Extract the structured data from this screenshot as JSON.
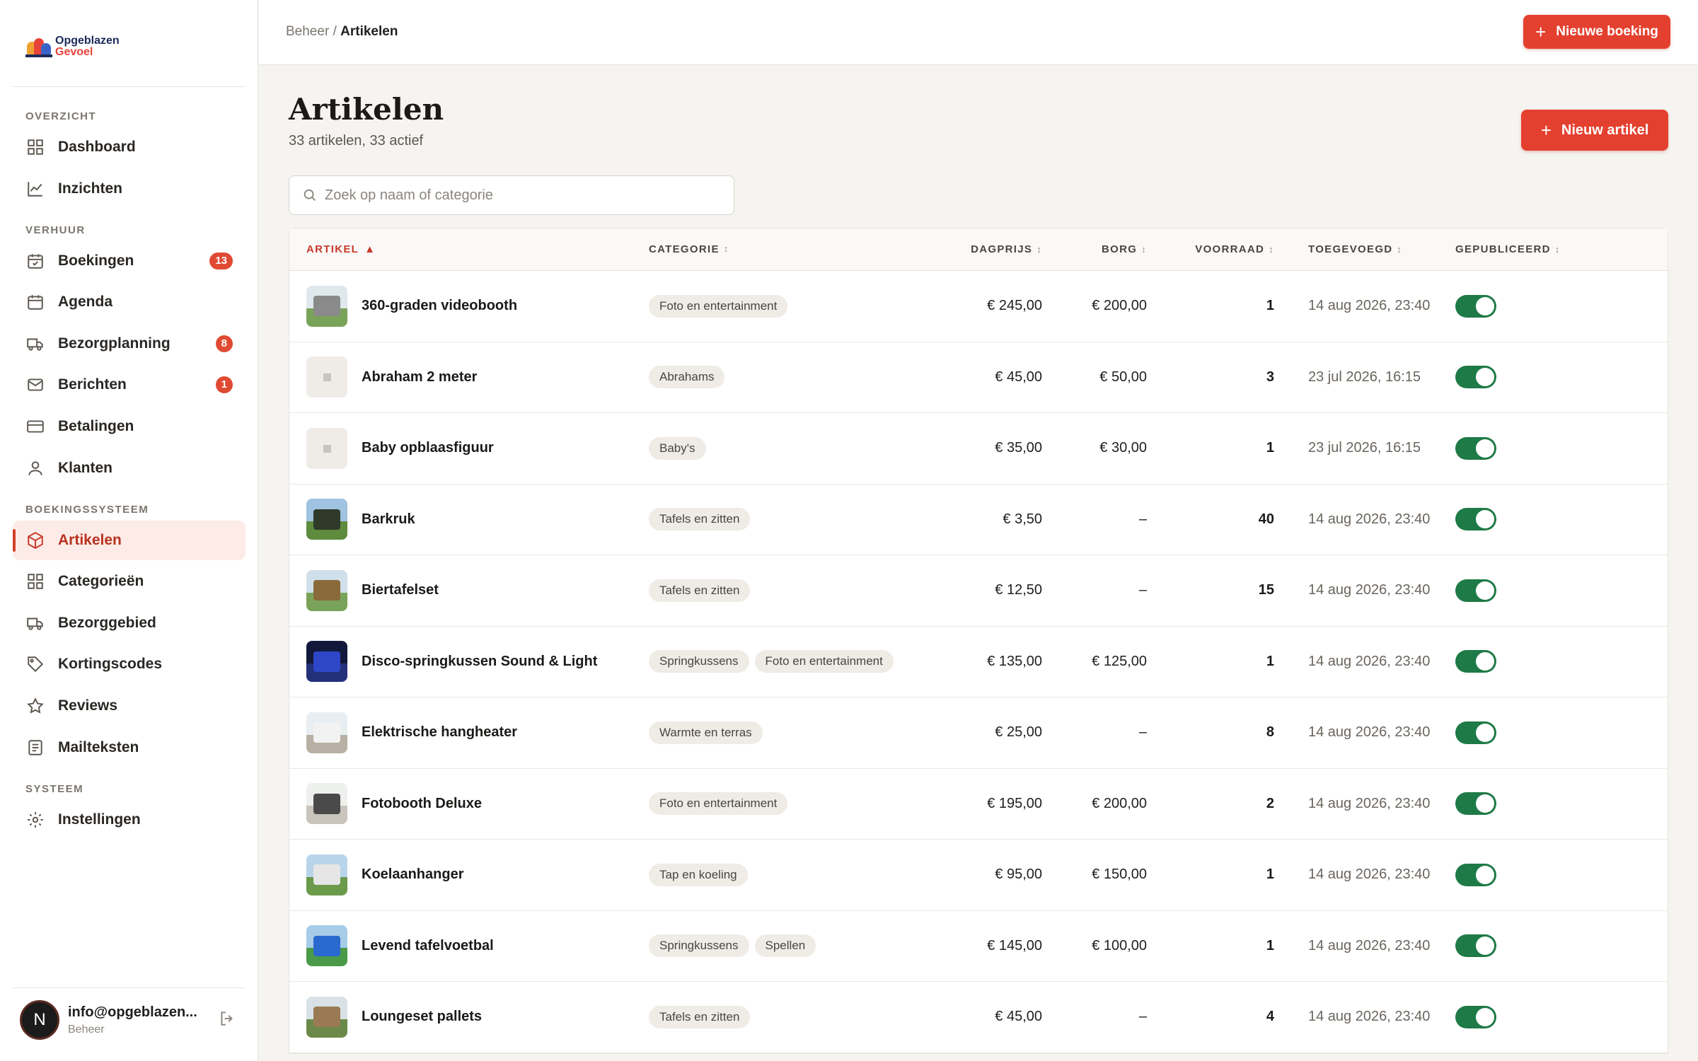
{
  "brand": {
    "line1": "Opgeblazen",
    "line2": "Gevoel"
  },
  "sidebar": {
    "sections": [
      {
        "title": "OVERZICHT",
        "items": [
          {
            "label": "Dashboard",
            "icon": "grid-icon"
          },
          {
            "label": "Inzichten",
            "icon": "chart-icon"
          }
        ]
      },
      {
        "title": "VERHUUR",
        "items": [
          {
            "label": "Boekingen",
            "icon": "calendar-check-icon",
            "badge": "13"
          },
          {
            "label": "Agenda",
            "icon": "calendar-icon"
          },
          {
            "label": "Bezorgplanning",
            "icon": "truck-icon",
            "badge": "8"
          },
          {
            "label": "Berichten",
            "icon": "mail-icon",
            "badge": "1"
          },
          {
            "label": "Betalingen",
            "icon": "credit-card-icon"
          },
          {
            "label": "Klanten",
            "icon": "user-icon"
          }
        ]
      },
      {
        "title": "BOEKINGSSYSTEEM",
        "items": [
          {
            "label": "Artikelen",
            "icon": "box-icon",
            "active": true
          },
          {
            "label": "Categorieën",
            "icon": "grid-icon"
          },
          {
            "label": "Bezorggebied",
            "icon": "truck-icon"
          },
          {
            "label": "Kortingscodes",
            "icon": "tag-icon"
          },
          {
            "label": "Reviews",
            "icon": "star-icon"
          },
          {
            "label": "Mailteksten",
            "icon": "document-icon"
          }
        ]
      },
      {
        "title": "SYSTEEM",
        "items": [
          {
            "label": "Instellingen",
            "icon": "gear-icon"
          }
        ]
      }
    ],
    "user": {
      "initial": "N",
      "email": "info@opgeblazen...",
      "role": "Beheer"
    }
  },
  "topbar": {
    "breadcrumb_parent": "Beheer",
    "breadcrumb_sep": "/",
    "breadcrumb_current": "Artikelen",
    "new_booking_label": "Nieuwe boeking"
  },
  "page": {
    "title": "Artikelen",
    "subtitle": "33 artikelen, 33 actief",
    "new_article_label": "Nieuw artikel",
    "search_placeholder": "Zoek op naam of categorie"
  },
  "table": {
    "columns": {
      "artikel": "ARTIKEL",
      "categorie": "CATEGORIE",
      "dagprijs": "DAGPRIJS",
      "borg": "BORG",
      "voorraad": "VOORRAAD",
      "toegevoegd": "TOEGEVOEGD",
      "gepubliceerd": "GEPUBLICEERD"
    },
    "rows": [
      {
        "name": "360-graden videobooth",
        "tags": [
          "Foto en entertainment"
        ],
        "price": "€ 245,00",
        "borg": "€ 200,00",
        "stock": "1",
        "date": "14 aug 2026, 23:40",
        "published": true,
        "thumb": "photo"
      },
      {
        "name": "Abraham 2 meter",
        "tags": [
          "Abrahams"
        ],
        "price": "€ 45,00",
        "borg": "€ 50,00",
        "stock": "3",
        "date": "23 jul 2026, 16:15",
        "published": true,
        "thumb": "placeholder"
      },
      {
        "name": "Baby opblaasfiguur",
        "tags": [
          "Baby's"
        ],
        "price": "€ 35,00",
        "borg": "€ 30,00",
        "stock": "1",
        "date": "23 jul 2026, 16:15",
        "published": true,
        "thumb": "placeholder"
      },
      {
        "name": "Barkruk",
        "tags": [
          "Tafels en zitten"
        ],
        "price": "€ 3,50",
        "borg": "–",
        "stock": "40",
        "date": "14 aug 2026, 23:40",
        "published": true,
        "thumb": "photo"
      },
      {
        "name": "Biertafelset",
        "tags": [
          "Tafels en zitten"
        ],
        "price": "€ 12,50",
        "borg": "–",
        "stock": "15",
        "date": "14 aug 2026, 23:40",
        "published": true,
        "thumb": "photo"
      },
      {
        "name": "Disco-springkussen Sound & Light",
        "tags": [
          "Springkussens",
          "Foto en entertainment"
        ],
        "price": "€ 135,00",
        "borg": "€ 125,00",
        "stock": "1",
        "date": "14 aug 2026, 23:40",
        "published": true,
        "thumb": "photo"
      },
      {
        "name": "Elektrische hangheater",
        "tags": [
          "Warmte en terras"
        ],
        "price": "€ 25,00",
        "borg": "–",
        "stock": "8",
        "date": "14 aug 2026, 23:40",
        "published": true,
        "thumb": "photo"
      },
      {
        "name": "Fotobooth Deluxe",
        "tags": [
          "Foto en entertainment"
        ],
        "price": "€ 195,00",
        "borg": "€ 200,00",
        "stock": "2",
        "date": "14 aug 2026, 23:40",
        "published": true,
        "thumb": "photo"
      },
      {
        "name": "Koelaanhanger",
        "tags": [
          "Tap en koeling"
        ],
        "price": "€ 95,00",
        "borg": "€ 150,00",
        "stock": "1",
        "date": "14 aug 2026, 23:40",
        "published": true,
        "thumb": "photo"
      },
      {
        "name": "Levend tafelvoetbal",
        "tags": [
          "Springkussens",
          "Spellen"
        ],
        "price": "€ 145,00",
        "borg": "€ 100,00",
        "stock": "1",
        "date": "14 aug 2026, 23:40",
        "published": true,
        "thumb": "photo"
      },
      {
        "name": "Loungeset pallets",
        "tags": [
          "Tafels en zitten"
        ],
        "price": "€ 45,00",
        "borg": "–",
        "stock": "4",
        "date": "14 aug 2026, 23:40",
        "published": true,
        "thumb": "photo"
      }
    ]
  },
  "colors": {
    "accent": "#e4402f",
    "toggle_on": "#1e7a46",
    "active_bg": "#fcebe7"
  }
}
